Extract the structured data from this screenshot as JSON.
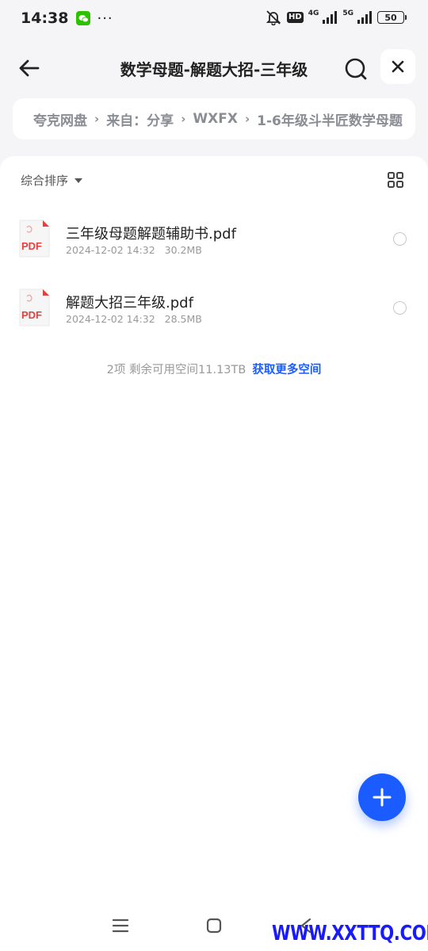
{
  "status_bar": {
    "time": "14:38",
    "more": "···",
    "hd_badge": "HD",
    "net_4g": "4G",
    "net_5g": "5G",
    "battery": "50",
    "icons": [
      "wechat-icon",
      "mute-icon",
      "signal-icon",
      "battery-icon"
    ]
  },
  "header": {
    "title": "数学母题-解题大招-三年级",
    "icons": [
      "back-arrow-icon",
      "search-icon",
      "close-icon"
    ]
  },
  "breadcrumb": {
    "items": [
      "夸克网盘",
      "来自：分享",
      "WXFX",
      "1-6年级斗半匠数学母题"
    ],
    "separator": "›"
  },
  "toolbar": {
    "sort_label": "综合排序",
    "icons": [
      "caret-down-icon",
      "grid-view-icon"
    ]
  },
  "files": [
    {
      "name": "三年级母题解题辅助书.pdf",
      "date": "2024-12-02 14:32",
      "size": "30.2MB",
      "icon": "pdf-file-icon",
      "icon_label": "PDF"
    },
    {
      "name": "解题大招三年级.pdf",
      "date": "2024-12-02 14:32",
      "size": "28.5MB",
      "icon": "pdf-file-icon",
      "icon_label": "PDF"
    }
  ],
  "footer": {
    "count_text": "2项 剩余可用空间11.13TB",
    "get_more": "获取更多空间"
  },
  "fab": {
    "icon": "plus-icon"
  },
  "navbar": {
    "icons": [
      "menu-icon",
      "home-icon",
      "back-icon"
    ]
  },
  "watermark": "WWW.XXTTQ.COM",
  "colors": {
    "accent": "#1a5cff",
    "pdf_red": "#e54040",
    "background": "#f5f5f7",
    "watermark": "#1a1aff"
  }
}
